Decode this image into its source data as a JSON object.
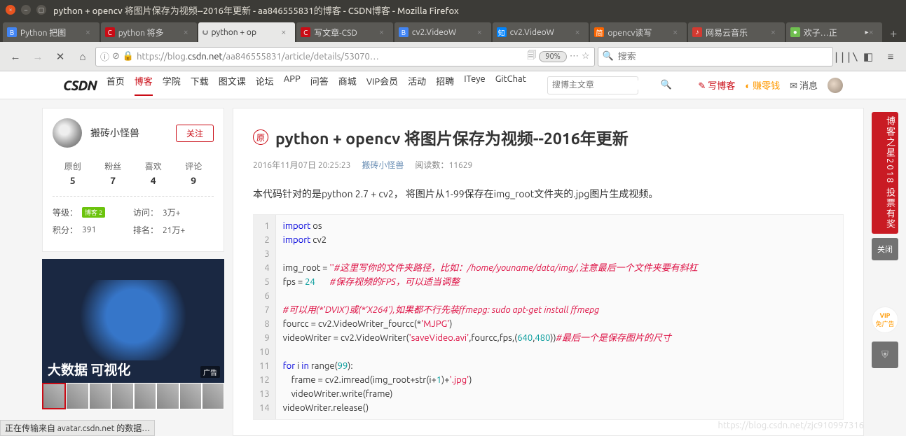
{
  "window": {
    "title": "python + opencv 将图片保存为视频--2016年更新 - aa846555831的博客 - CSDN博客 - Mozilla Firefox"
  },
  "tabs": [
    {
      "label": "Python 把图",
      "favicon_bg": "#4285f4",
      "favicon_txt": "B"
    },
    {
      "label": "python 将多",
      "favicon_bg": "#ca0c16",
      "favicon_txt": "C"
    },
    {
      "label": "python + op",
      "active": true,
      "loading": true
    },
    {
      "label": "写文章-CSD",
      "favicon_bg": "#ca0c16",
      "favicon_txt": "C"
    },
    {
      "label": "cv2.VideoW",
      "favicon_bg": "#4285f4",
      "favicon_txt": "B"
    },
    {
      "label": "cv2.VideoW",
      "favicon_bg": "#0084ff",
      "favicon_txt": "知"
    },
    {
      "label": "opencv读写",
      "favicon_bg": "#fa6400",
      "favicon_txt": "简"
    },
    {
      "label": "网易云音乐",
      "favicon_bg": "#d33a31",
      "favicon_txt": "♪"
    },
    {
      "label": "欢子…正",
      "favicon_bg": "#70c050",
      "favicon_txt": "●",
      "extra": "▸"
    }
  ],
  "nav": {
    "url_prefix": "https://blog.",
    "url_host": "csdn.net",
    "url_path": "/aa846555831/article/details/53070…",
    "zoom": "90%",
    "search_placeholder": "搜索"
  },
  "csdn": {
    "logo": "CSDN",
    "menu": [
      "首页",
      "博客",
      "学院",
      "下载",
      "图文课",
      "论坛",
      "APP",
      "问答",
      "商城",
      "VIP会员",
      "活动",
      "招聘",
      "ITeye",
      "GitChat"
    ],
    "active_menu": 1,
    "search_placeholder": "搜博主文章",
    "write": "写博客",
    "earn": "赚零钱",
    "msg": "消息"
  },
  "author": {
    "name": "搬砖小怪兽",
    "follow": "关注",
    "stats": [
      {
        "lbl": "原创",
        "val": "5"
      },
      {
        "lbl": "粉丝",
        "val": "7"
      },
      {
        "lbl": "喜欢",
        "val": "4"
      },
      {
        "lbl": "评论",
        "val": "9"
      }
    ],
    "level_lbl": "等级：",
    "level_badge": "博客 2",
    "visit_lbl": "访问：",
    "visit_val": "3万+",
    "score_lbl": "积分：",
    "score_val": "391",
    "rank_lbl": "排名：",
    "rank_val": "21万+"
  },
  "ad": {
    "title": "大数据 可视化",
    "tag": "广告"
  },
  "article": {
    "badge": "原",
    "title": "python + opencv 将图片保存为视频--2016年更新",
    "date": "2016年11月07日 20:25:23",
    "author": "搬砖小怪兽",
    "reads_lbl": "阅读数：",
    "reads": "11629",
    "body": "本代码针对的是python 2.7 + cv2， 将图片从1-99保存在img_root文件夹的.jpg图片生成视频。"
  },
  "code_lines": 14,
  "rail": {
    "banner": "博客之星2018 投票有奖",
    "close": "关闭",
    "vip1": "VIP",
    "vip2": "免广告"
  },
  "status": "正在传输来自 avatar.csdn.net 的数据…",
  "watermark": "https://blog.csdn.net/zjc910997316"
}
